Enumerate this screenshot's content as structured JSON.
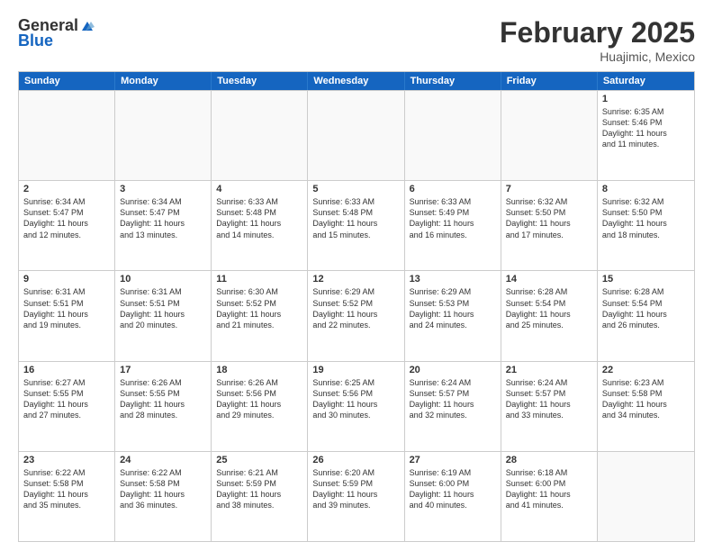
{
  "header": {
    "logo_general": "General",
    "logo_blue": "Blue",
    "title": "February 2025",
    "location": "Huajimic, Mexico"
  },
  "days_of_week": [
    "Sunday",
    "Monday",
    "Tuesday",
    "Wednesday",
    "Thursday",
    "Friday",
    "Saturday"
  ],
  "rows": [
    [
      {
        "day": "",
        "empty": true
      },
      {
        "day": "",
        "empty": true
      },
      {
        "day": "",
        "empty": true
      },
      {
        "day": "",
        "empty": true
      },
      {
        "day": "",
        "empty": true
      },
      {
        "day": "",
        "empty": true
      },
      {
        "day": "1",
        "lines": [
          "Sunrise: 6:35 AM",
          "Sunset: 5:46 PM",
          "Daylight: 11 hours",
          "and 11 minutes."
        ]
      }
    ],
    [
      {
        "day": "2",
        "lines": [
          "Sunrise: 6:34 AM",
          "Sunset: 5:47 PM",
          "Daylight: 11 hours",
          "and 12 minutes."
        ]
      },
      {
        "day": "3",
        "lines": [
          "Sunrise: 6:34 AM",
          "Sunset: 5:47 PM",
          "Daylight: 11 hours",
          "and 13 minutes."
        ]
      },
      {
        "day": "4",
        "lines": [
          "Sunrise: 6:33 AM",
          "Sunset: 5:48 PM",
          "Daylight: 11 hours",
          "and 14 minutes."
        ]
      },
      {
        "day": "5",
        "lines": [
          "Sunrise: 6:33 AM",
          "Sunset: 5:48 PM",
          "Daylight: 11 hours",
          "and 15 minutes."
        ]
      },
      {
        "day": "6",
        "lines": [
          "Sunrise: 6:33 AM",
          "Sunset: 5:49 PM",
          "Daylight: 11 hours",
          "and 16 minutes."
        ]
      },
      {
        "day": "7",
        "lines": [
          "Sunrise: 6:32 AM",
          "Sunset: 5:50 PM",
          "Daylight: 11 hours",
          "and 17 minutes."
        ]
      },
      {
        "day": "8",
        "lines": [
          "Sunrise: 6:32 AM",
          "Sunset: 5:50 PM",
          "Daylight: 11 hours",
          "and 18 minutes."
        ]
      }
    ],
    [
      {
        "day": "9",
        "lines": [
          "Sunrise: 6:31 AM",
          "Sunset: 5:51 PM",
          "Daylight: 11 hours",
          "and 19 minutes."
        ]
      },
      {
        "day": "10",
        "lines": [
          "Sunrise: 6:31 AM",
          "Sunset: 5:51 PM",
          "Daylight: 11 hours",
          "and 20 minutes."
        ]
      },
      {
        "day": "11",
        "lines": [
          "Sunrise: 6:30 AM",
          "Sunset: 5:52 PM",
          "Daylight: 11 hours",
          "and 21 minutes."
        ]
      },
      {
        "day": "12",
        "lines": [
          "Sunrise: 6:29 AM",
          "Sunset: 5:52 PM",
          "Daylight: 11 hours",
          "and 22 minutes."
        ]
      },
      {
        "day": "13",
        "lines": [
          "Sunrise: 6:29 AM",
          "Sunset: 5:53 PM",
          "Daylight: 11 hours",
          "and 24 minutes."
        ]
      },
      {
        "day": "14",
        "lines": [
          "Sunrise: 6:28 AM",
          "Sunset: 5:54 PM",
          "Daylight: 11 hours",
          "and 25 minutes."
        ]
      },
      {
        "day": "15",
        "lines": [
          "Sunrise: 6:28 AM",
          "Sunset: 5:54 PM",
          "Daylight: 11 hours",
          "and 26 minutes."
        ]
      }
    ],
    [
      {
        "day": "16",
        "lines": [
          "Sunrise: 6:27 AM",
          "Sunset: 5:55 PM",
          "Daylight: 11 hours",
          "and 27 minutes."
        ]
      },
      {
        "day": "17",
        "lines": [
          "Sunrise: 6:26 AM",
          "Sunset: 5:55 PM",
          "Daylight: 11 hours",
          "and 28 minutes."
        ]
      },
      {
        "day": "18",
        "lines": [
          "Sunrise: 6:26 AM",
          "Sunset: 5:56 PM",
          "Daylight: 11 hours",
          "and 29 minutes."
        ]
      },
      {
        "day": "19",
        "lines": [
          "Sunrise: 6:25 AM",
          "Sunset: 5:56 PM",
          "Daylight: 11 hours",
          "and 30 minutes."
        ]
      },
      {
        "day": "20",
        "lines": [
          "Sunrise: 6:24 AM",
          "Sunset: 5:57 PM",
          "Daylight: 11 hours",
          "and 32 minutes."
        ]
      },
      {
        "day": "21",
        "lines": [
          "Sunrise: 6:24 AM",
          "Sunset: 5:57 PM",
          "Daylight: 11 hours",
          "and 33 minutes."
        ]
      },
      {
        "day": "22",
        "lines": [
          "Sunrise: 6:23 AM",
          "Sunset: 5:58 PM",
          "Daylight: 11 hours",
          "and 34 minutes."
        ]
      }
    ],
    [
      {
        "day": "23",
        "lines": [
          "Sunrise: 6:22 AM",
          "Sunset: 5:58 PM",
          "Daylight: 11 hours",
          "and 35 minutes."
        ]
      },
      {
        "day": "24",
        "lines": [
          "Sunrise: 6:22 AM",
          "Sunset: 5:58 PM",
          "Daylight: 11 hours",
          "and 36 minutes."
        ]
      },
      {
        "day": "25",
        "lines": [
          "Sunrise: 6:21 AM",
          "Sunset: 5:59 PM",
          "Daylight: 11 hours",
          "and 38 minutes."
        ]
      },
      {
        "day": "26",
        "lines": [
          "Sunrise: 6:20 AM",
          "Sunset: 5:59 PM",
          "Daylight: 11 hours",
          "and 39 minutes."
        ]
      },
      {
        "day": "27",
        "lines": [
          "Sunrise: 6:19 AM",
          "Sunset: 6:00 PM",
          "Daylight: 11 hours",
          "and 40 minutes."
        ]
      },
      {
        "day": "28",
        "lines": [
          "Sunrise: 6:18 AM",
          "Sunset: 6:00 PM",
          "Daylight: 11 hours",
          "and 41 minutes."
        ]
      },
      {
        "day": "",
        "empty": true
      }
    ]
  ]
}
